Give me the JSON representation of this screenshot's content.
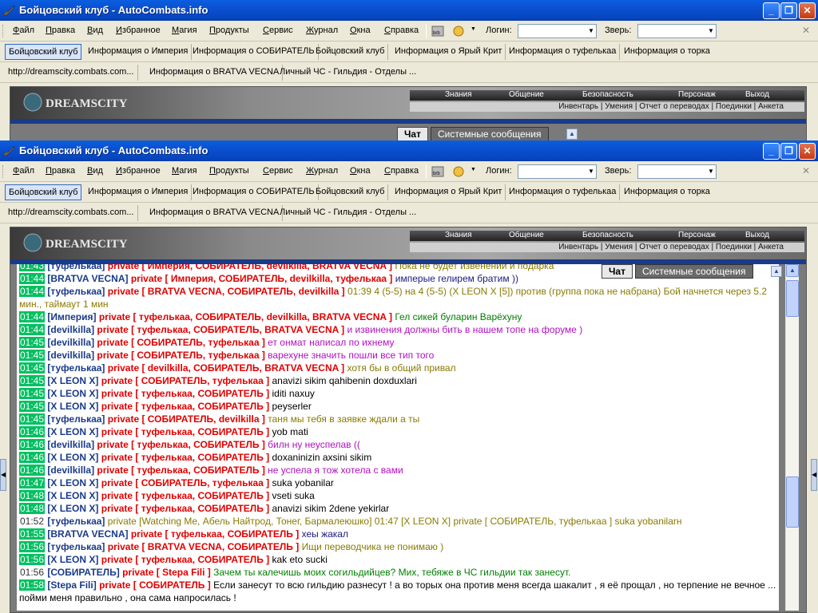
{
  "window": {
    "title": "Бойцовский клуб - AutoCombats.info",
    "min_icon": "minimize-icon",
    "max_icon": "maximize-icon",
    "close_icon": "close-icon"
  },
  "menu": {
    "items": [
      "Файл",
      "Правка",
      "Вид",
      "Избранное",
      "Магия",
      "Продукты",
      "Сервис",
      "Журнал",
      "Окна",
      "Справка"
    ],
    "login_label": "Логин:",
    "login_value": "",
    "beast_label": "Зверь:",
    "beast_value": ""
  },
  "tabs": {
    "row1": [
      "Бойцовский клуб",
      "Информация о Империя",
      "Информация о СОБИРАТЕЛЬ",
      "Бойцовский клуб",
      "Информация о Ярый Крит",
      "Информация о туфелькаа",
      "Информация о торка"
    ],
    "row2": [
      "http://dreamscity.combats.com...",
      "Информация о BRATVA VECNA",
      "Личный ЧС - Гильдия - Отделы ..."
    ]
  },
  "site": {
    "logo": "DREAMSCITY",
    "nav": [
      "Знания",
      "Общение",
      "Безопасность",
      "Персонаж",
      "Выход"
    ],
    "subnav": "Инвентарь | Умения | Отчет о переводах | Поединки | Анкета",
    "chat_tab": "Чат",
    "system_tab": "Системные сообщения"
  },
  "chat": [
    {
      "time": "01:43",
      "nick": "туфелькаа",
      "to": "Империя, СОБИРАТЕЛЬ, devilkilla, BRATVA VECNA",
      "msg": "Пока не будет извенений и подарка",
      "color": "olive"
    },
    {
      "time": "01:44",
      "nick": "BRATVA VECNA",
      "to": "Империя, СОБИРАТЕЛЬ, devilkilla, туфелькаа",
      "msg": "имперые гелирем братим ))",
      "color": "navy"
    },
    {
      "time": "01:44",
      "nick": "туфелькаа",
      "to": "BRATVA VECNA, СОБИРАТЕЛЬ, devilkilla",
      "msg": "01:39 4 (5-5) на 4 (5-5) (X LEON X [5]) против (группа пока не набрана) Бой начнется через 5.2 мин., таймаут 1 мин",
      "color": "olive",
      "wrap": true
    },
    {
      "time": "01:44",
      "nick": "Империя",
      "to": "туфелькаа, СОБИРАТЕЛЬ, devilkilla, BRATVA VECNA",
      "msg": "Гел сикей буларин Варёхуну",
      "color": "green"
    },
    {
      "time": "01:44",
      "nick": "devilkilla",
      "to": "туфелькаа, СОБИРАТЕЛЬ, BRATVA VECNA",
      "msg": "и извинения должны бить в нашем топе на форуме )",
      "color": "violet"
    },
    {
      "time": "01:45",
      "nick": "devilkilla",
      "to": "СОБИРАТЕЛЬ, туфелькаа",
      "msg": "ет онмат написал по ихнему",
      "color": "violet"
    },
    {
      "time": "01:45",
      "nick": "devilkilla",
      "to": "СОБИРАТЕЛЬ, туфелькаа",
      "msg": "варехуне значить пошли все тип того",
      "color": "violet"
    },
    {
      "time": "01:45",
      "nick": "туфелькаа",
      "to": "devilkilla, СОБИРАТЕЛЬ, BRATVA VECNA",
      "msg": "хотя бы в общий привал",
      "color": "olive"
    },
    {
      "time": "01:45",
      "nick": "X LEON X",
      "to": "СОБИРАТЕЛЬ, туфелькаа",
      "msg": "anavizi sikim qahibenin doxduxlari",
      "color": "black"
    },
    {
      "time": "01:45",
      "nick": "X LEON X",
      "to": "туфелькаа, СОБИРАТЕЛЬ",
      "msg": "iditi naxuy",
      "color": "black"
    },
    {
      "time": "01:45",
      "nick": "X LEON X",
      "to": "туфелькаа, СОБИРАТЕЛЬ",
      "msg": "peyserler",
      "color": "black"
    },
    {
      "time": "01:45",
      "nick": "туфелькаа",
      "to": "СОБИРАТЕЛЬ, devilkilla",
      "msg": "таня мы тебя в заявке ждали а ты",
      "color": "olive"
    },
    {
      "time": "01:46",
      "nick": "X LEON X",
      "to": "туфелькаа, СОБИРАТЕЛЬ",
      "msg": "yob mati",
      "color": "black"
    },
    {
      "time": "01:46",
      "nick": "devilkilla",
      "to": "туфелькаа, СОБИРАТЕЛЬ",
      "msg": "билн ну неуспелав ((",
      "color": "violet"
    },
    {
      "time": "01:46",
      "nick": "X LEON X",
      "to": "туфелькаа, СОБИРАТЕЛЬ",
      "msg": "doxaninizin axsini sikim",
      "color": "black"
    },
    {
      "time": "01:46",
      "nick": "devilkilla",
      "to": "туфелькаа, СОБИРАТЕЛЬ",
      "msg": "не успела я тож хотела с вами",
      "color": "violet"
    },
    {
      "time": "01:47",
      "nick": "X LEON X",
      "to": "СОБИРАТЕЛЬ, туфелькаа",
      "msg": "suka yobanilar",
      "color": "black"
    },
    {
      "time": "01:48",
      "nick": "X LEON X",
      "to": "туфелькаа, СОБИРАТЕЛЬ",
      "msg": "vseti suka",
      "color": "black"
    },
    {
      "time": "01:48",
      "nick": "X LEON X",
      "to": "туфелькаа, СОБИРАТЕЛЬ",
      "msg": "anavizi sikim 2dene yekirlar",
      "color": "black"
    },
    {
      "time": "01:52",
      "plain": true,
      "nick": "туфелькаа",
      "raw": "private [Watching Me, Абель Найтрод, Тонег, Бармалеюшко] 01:47 [X LEON X] private [ СОБИРАТЕЛЬ, туфелькаа ] suka yobanilarн",
      "color": "olive"
    },
    {
      "time": "01:55",
      "nick": "BRATVA VECNA",
      "to": "туфелькаа, СОБИРАТЕЛЬ",
      "msg": "хеы жакал",
      "color": "navy"
    },
    {
      "time": "01:56",
      "nick": "туфелькаа",
      "to": "BRATVA VECNA, СОБИРАТЕЛЬ",
      "msg": "Ищи переводчика не понимаю )",
      "color": "olive"
    },
    {
      "time": "01:56",
      "nick": "X LEON X",
      "to": "туфелькаа, СОБИРАТЕЛЬ",
      "msg": "kak eto sucki",
      "color": "black"
    },
    {
      "time": "01:56",
      "plain": true,
      "nick": "СОБИРАТЕЛЬ",
      "to": "Stepa Fili",
      "msg": "Зачем ты калечишь моих согильдийцев? Мих, тебяже в ЧС гильдии так занесут.",
      "color": "green"
    },
    {
      "time": "01:58",
      "nick": "Stepa Fili",
      "to": "СОБИРАТЕЛЬ",
      "msg": "Если занесут то всю гильдию разнесут ! а во торых она против меня всегда шакалит , я её прощал , но терпение не вечное ... пойми меня правильно , она сама напросилась !",
      "color": "black",
      "wrap": true
    }
  ]
}
